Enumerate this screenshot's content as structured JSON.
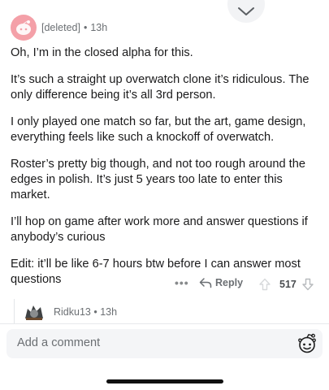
{
  "comment": {
    "username": "[deleted]",
    "separator": "•",
    "time": "13h",
    "paragraphs": [
      "Oh, I’m in the closed alpha for this.",
      "It’s such a straight up overwatch clone it’s ridiculous. The only difference being it’s all 3rd person.",
      "I only played one match so far, but the art, game design, everything feels like such a knockoff of overwatch.",
      "Roster’s pretty big though, and not too rough around the edges in polish. It’s just 5 years too late to enter this market.",
      "I’ll hop on game after work more and answer questions if anybody’s curious",
      "Edit: it’ll be like 6-7 hours btw before I can answer most questions"
    ],
    "more_label": "•••",
    "reply_label": "Reply",
    "score": "517"
  },
  "reply_preview": {
    "username": "Ridku13",
    "separator": "•",
    "time": "13h"
  },
  "composer": {
    "placeholder": "Add a comment"
  },
  "icons": {
    "collapse": "chevron-down-icon",
    "reply": "reply-arrow-icon",
    "upvote": "upvote-arrow-icon",
    "downvote": "downvote-arrow-icon",
    "snoo": "snoo-icon"
  },
  "colors": {
    "avatar_bg": "#f4a0a8",
    "meta_text": "#6b6f73",
    "input_bg": "#f4f5f7"
  }
}
